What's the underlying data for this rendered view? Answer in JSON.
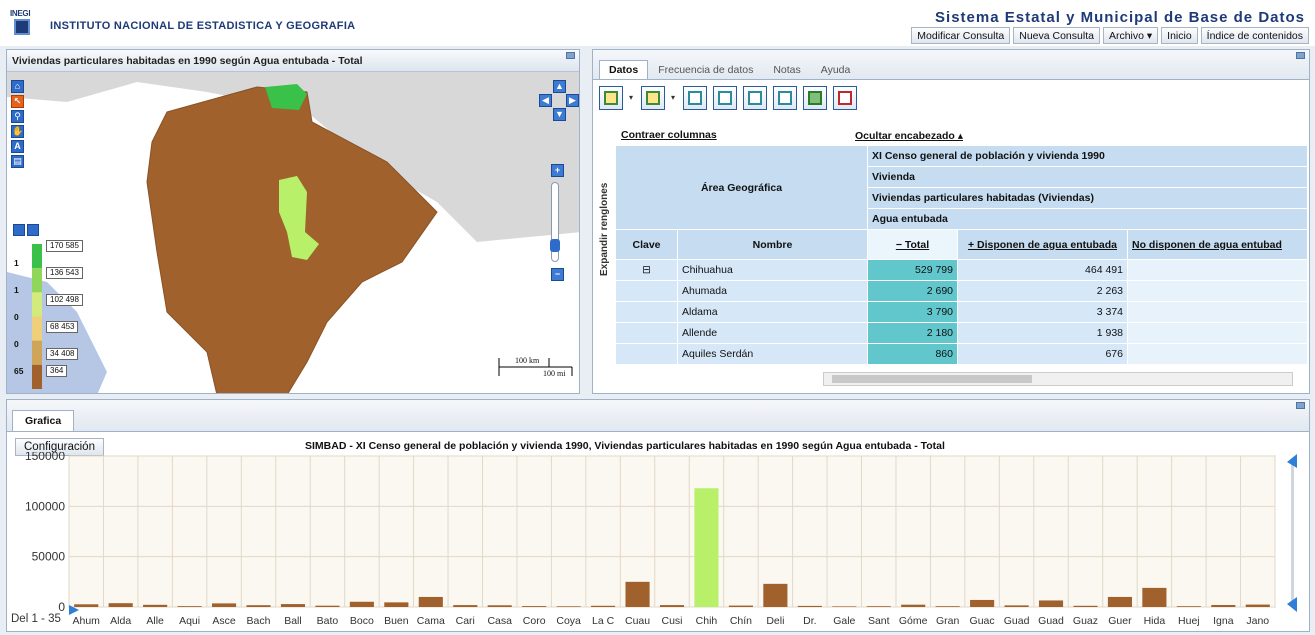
{
  "header": {
    "logo_text": "INEGI",
    "institute": "INSTITUTO NACIONAL DE ESTADISTICA Y GEOGRAFIA",
    "system_title": "Sistema Estatal y Municipal de Base de Datos",
    "nav": [
      "Modificar Consulta",
      "Nueva Consulta",
      "Archivo ▾",
      "Inicio",
      "Índice de contenidos"
    ]
  },
  "map": {
    "title": "Viviendas particulares habitadas en 1990 según Agua entubada - Total",
    "legend_counts": [
      "1",
      "1",
      "0",
      "0",
      "65"
    ],
    "legend_values": [
      "170 585",
      "136 543",
      "102 498",
      "68 453",
      "34 408",
      "364"
    ],
    "legend_colors": [
      "#39c14a",
      "#8fd65a",
      "#d3ea7c",
      "#f0cf7a",
      "#cfa55a",
      "#a0612c"
    ],
    "scale_km": "100 km",
    "scale_mi": "100 mi"
  },
  "data_panel": {
    "tabs": [
      "Datos",
      "Frecuencia de datos",
      "Notas",
      "Ayuda"
    ],
    "active_tab": "Datos",
    "collapse_cols": "Contraer columnas",
    "hide_header": "Ocultar encabezado ▴",
    "expand_rows": "Expandir renglones",
    "header": {
      "geo": "Área Geográfica",
      "census": "XI Censo general de población y vivienda 1990",
      "vivienda": "Vivienda",
      "vph": "Viviendas particulares habitadas (Viviendas)",
      "agua": "Agua entubada",
      "clave": "Clave",
      "nombre": "Nombre",
      "total": "− Total",
      "disponen": "+ Disponen de agua entubada",
      "no_disponen": "No disponen de agua entubad"
    },
    "rows": [
      {
        "clave": "⊟",
        "nombre": "Chihuahua",
        "total": "529 799",
        "disponen": "464 491"
      },
      {
        "clave": "",
        "nombre": "Ahumada",
        "total": "2 690",
        "disponen": "2 263"
      },
      {
        "clave": "",
        "nombre": "Aldama",
        "total": "3 790",
        "disponen": "3 374"
      },
      {
        "clave": "",
        "nombre": "Allende",
        "total": "2 180",
        "disponen": "1 938"
      },
      {
        "clave": "",
        "nombre": "Aquiles Serdán",
        "total": "860",
        "disponen": "676"
      }
    ]
  },
  "chart_panel": {
    "tab": "Grafica",
    "config_button": "Configuración",
    "range_label": "Del 1 - 35"
  },
  "chart_data": {
    "type": "bar",
    "title": "SIMBAD - XI Censo general de población y vivienda 1990, Viviendas particulares habitadas en 1990 según Agua entubada - Total",
    "xlabel": "",
    "ylabel": "",
    "ylim": [
      0,
      150000
    ],
    "yticks": [
      0,
      50000,
      100000,
      150000
    ],
    "categories": [
      "Ahum",
      "Alda",
      "Alle",
      "Aqui",
      "Asce",
      "Bach",
      "Ball",
      "Bato",
      "Boco",
      "Buen",
      "Cama",
      "Cari",
      "Casa",
      "Coro",
      "Coya",
      "La C",
      "Cuau",
      "Cusi",
      "Chih",
      "Chín",
      "Deli",
      "Dr.",
      "Gale",
      "Sant",
      "Góme",
      "Gran",
      "Guac",
      "Guad",
      "Guad",
      "Guaz",
      "Guer",
      "Hida",
      "Huej",
      "Igna",
      "Jano"
    ],
    "values": [
      2690,
      3790,
      2180,
      860,
      3600,
      1800,
      2900,
      1300,
      5200,
      4600,
      10000,
      1900,
      1700,
      900,
      700,
      1200,
      25000,
      1900,
      118000,
      1400,
      23000,
      1100,
      600,
      800,
      2300,
      800,
      7000,
      1600,
      6500,
      1200,
      10000,
      19000,
      800,
      2000,
      2400
    ],
    "bar_color": "#a0612c",
    "highlight_color": "#b8f06a",
    "highlight_index": 18,
    "grid": true
  }
}
